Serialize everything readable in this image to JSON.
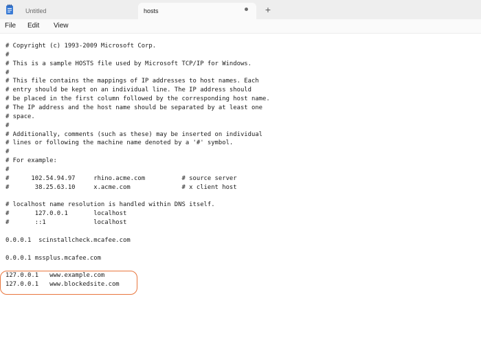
{
  "tabs": [
    {
      "label": "Untitled",
      "active": false
    },
    {
      "label": "hosts",
      "active": true,
      "unsaved_indicator": "dot"
    }
  ],
  "new_tab_label": "+",
  "menu": [
    "File",
    "Edit",
    "View"
  ],
  "colors": {
    "highlight_border": "#e8743b",
    "app_icon": "#3a7bd5"
  },
  "icons": {
    "app": "notepad-icon",
    "unsaved": "unsaved-dot-icon",
    "new_tab": "plus-icon"
  },
  "editor": {
    "lines": [
      "# Copyright (c) 1993-2009 Microsoft Corp.",
      "#",
      "# This is a sample HOSTS file used by Microsoft TCP/IP for Windows.",
      "#",
      "# This file contains the mappings of IP addresses to host names. Each",
      "# entry should be kept on an individual line. The IP address should",
      "# be placed in the first column followed by the corresponding host name.",
      "# The IP address and the host name should be separated by at least one",
      "# space.",
      "#",
      "# Additionally, comments (such as these) may be inserted on individual",
      "# lines or following the machine name denoted by a '#' symbol.",
      "#",
      "# For example:",
      "#",
      "#      102.54.94.97     rhino.acme.com          # source server",
      "#       38.25.63.10     x.acme.com              # x client host",
      "",
      "# localhost name resolution is handled within DNS itself.",
      "#       127.0.0.1       localhost",
      "#       ::1             localhost",
      "",
      "0.0.0.1  scinstallcheck.mcafee.com",
      "",
      "0.0.0.1 mssplus.mcafee.com",
      "",
      "127.0.0.1   www.example.com",
      "127.0.0.1   www.blockedsite.com"
    ]
  }
}
